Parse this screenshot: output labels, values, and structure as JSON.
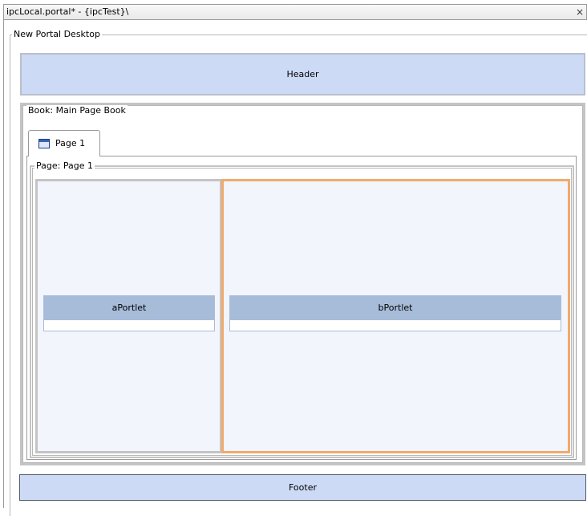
{
  "editor": {
    "title": "ipcLocal.portal* - {ipcTest}\\",
    "close_glyph": "×"
  },
  "desktop": {
    "label": "New Portal Desktop",
    "header_label": "Header",
    "footer_label": "Footer"
  },
  "book": {
    "label": "Book: Main Page Book",
    "tabs": [
      {
        "label": "Page 1",
        "icon": "page-icon",
        "selected": true
      }
    ]
  },
  "page": {
    "label": "Page: Page 1",
    "columns": [
      {
        "portlet": {
          "title": "aPortlet"
        },
        "selected": false
      },
      {
        "portlet": {
          "title": "bPortlet"
        },
        "selected": true
      }
    ]
  },
  "colors": {
    "header_footer_fill": "#cddaf6",
    "portlet_title_fill": "#a7bcd9",
    "column_fill": "#f2f5fc",
    "selection_border": "#f0ab6c"
  }
}
